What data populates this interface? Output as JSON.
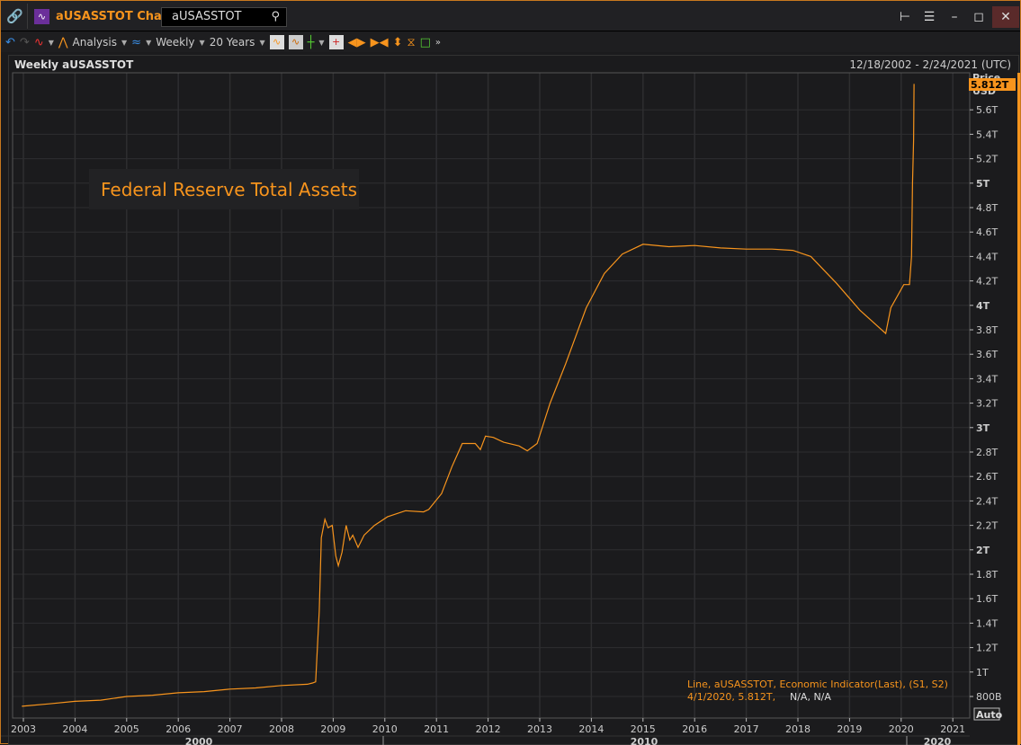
{
  "window": {
    "title": "aUSASSTOT Chart",
    "search_value": "aUSASSTOT"
  },
  "toolbar": {
    "analysis": "Analysis",
    "interval": "Weekly",
    "range": "20 Years"
  },
  "chart_header": {
    "title": "Weekly aUSASSTOT",
    "date_range": "12/18/2002 - 2/24/2021 (UTC)"
  },
  "annotation": "Federal Reserve Total Assets",
  "legend": {
    "line1": "Line, aUSASSTOT, Economic Indicator(Last), (S1, S2)",
    "line2_date": "4/1/2020, 5.812T,",
    "line2_na": "N/A, N/A"
  },
  "axis": {
    "price_label": "Price",
    "currency": "USD",
    "last_value": "5.812T",
    "auto": "Auto",
    "decades": [
      "2000",
      "2010",
      "2020"
    ]
  },
  "colors": {
    "line": "#f7941d",
    "accent": "#f7941d",
    "background": "#1b1b1d",
    "grid": "#2e2e30"
  },
  "chart_data": {
    "type": "line",
    "title": "Federal Reserve Total Assets",
    "ylabel": "Price USD",
    "xlim": [
      2002.8,
      2021.3
    ],
    "ylim": [
      0.66,
      5.95
    ],
    "y_unit": "T",
    "yticks": [
      0.8,
      1,
      1.2,
      1.4,
      1.6,
      1.8,
      2,
      2.2,
      2.4,
      2.6,
      2.8,
      3,
      3.2,
      3.4,
      3.6,
      3.8,
      4,
      4.2,
      4.4,
      4.6,
      4.8,
      5,
      5.2,
      5.4,
      5.6
    ],
    "ytick_labels": [
      "800B",
      "1T",
      "1.2T",
      "1.4T",
      "1.6T",
      "1.8T",
      "2T",
      "2.2T",
      "2.4T",
      "2.6T",
      "2.8T",
      "3T",
      "3.2T",
      "3.4T",
      "3.6T",
      "3.8T",
      "4T",
      "4.2T",
      "4.4T",
      "4.6T",
      "4.8T",
      "5T",
      "5.2T",
      "5.4T",
      "5.6T"
    ],
    "xticks": [
      2003,
      2004,
      2005,
      2006,
      2007,
      2008,
      2009,
      2010,
      2011,
      2012,
      2013,
      2014,
      2015,
      2016,
      2017,
      2018,
      2019,
      2020,
      2021
    ],
    "series": [
      {
        "name": "aUSASSTOT",
        "points": [
          [
            2002.97,
            0.72
          ],
          [
            2003.5,
            0.74
          ],
          [
            2004.0,
            0.76
          ],
          [
            2004.5,
            0.77
          ],
          [
            2005.0,
            0.8
          ],
          [
            2005.5,
            0.81
          ],
          [
            2006.0,
            0.83
          ],
          [
            2006.5,
            0.84
          ],
          [
            2007.0,
            0.86
          ],
          [
            2007.5,
            0.87
          ],
          [
            2008.0,
            0.89
          ],
          [
            2008.5,
            0.9
          ],
          [
            2008.6,
            0.91
          ],
          [
            2008.66,
            0.92
          ],
          [
            2008.73,
            1.5
          ],
          [
            2008.77,
            2.1
          ],
          [
            2008.84,
            2.25
          ],
          [
            2008.9,
            2.18
          ],
          [
            2008.98,
            2.2
          ],
          [
            2009.05,
            1.95
          ],
          [
            2009.1,
            1.87
          ],
          [
            2009.17,
            1.98
          ],
          [
            2009.25,
            2.2
          ],
          [
            2009.32,
            2.08
          ],
          [
            2009.38,
            2.12
          ],
          [
            2009.48,
            2.02
          ],
          [
            2009.6,
            2.12
          ],
          [
            2009.8,
            2.2
          ],
          [
            2010.05,
            2.27
          ],
          [
            2010.4,
            2.32
          ],
          [
            2010.75,
            2.31
          ],
          [
            2010.85,
            2.33
          ],
          [
            2011.1,
            2.46
          ],
          [
            2011.3,
            2.68
          ],
          [
            2011.5,
            2.87
          ],
          [
            2011.75,
            2.87
          ],
          [
            2011.85,
            2.82
          ],
          [
            2011.95,
            2.93
          ],
          [
            2012.1,
            2.92
          ],
          [
            2012.3,
            2.88
          ],
          [
            2012.6,
            2.85
          ],
          [
            2012.76,
            2.81
          ],
          [
            2012.95,
            2.87
          ],
          [
            2013.2,
            3.2
          ],
          [
            2013.5,
            3.52
          ],
          [
            2013.9,
            3.98
          ],
          [
            2014.25,
            4.26
          ],
          [
            2014.6,
            4.42
          ],
          [
            2015.0,
            4.5
          ],
          [
            2015.5,
            4.48
          ],
          [
            2016.0,
            4.49
          ],
          [
            2016.5,
            4.47
          ],
          [
            2017.0,
            4.46
          ],
          [
            2017.5,
            4.46
          ],
          [
            2017.9,
            4.45
          ],
          [
            2018.25,
            4.4
          ],
          [
            2018.75,
            4.18
          ],
          [
            2019.2,
            3.96
          ],
          [
            2019.7,
            3.77
          ],
          [
            2019.8,
            3.98
          ],
          [
            2020.05,
            4.17
          ],
          [
            2020.16,
            4.17
          ],
          [
            2020.2,
            4.4
          ],
          [
            2020.22,
            5.0
          ],
          [
            2020.24,
            5.35
          ],
          [
            2020.25,
            5.812
          ]
        ]
      }
    ]
  }
}
